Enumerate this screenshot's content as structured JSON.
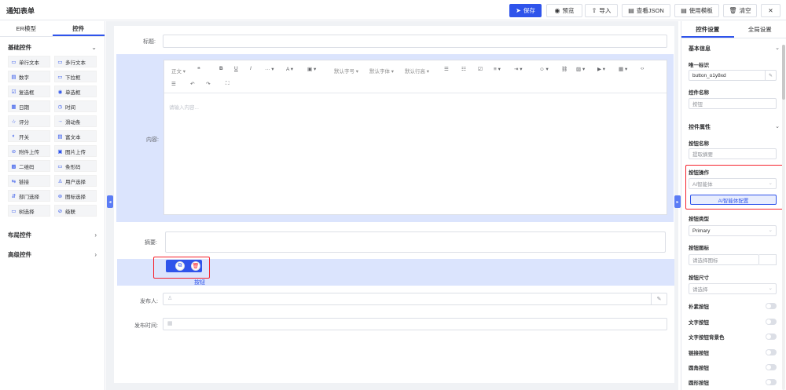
{
  "app": {
    "title": "通知表单"
  },
  "toolbar": {
    "save": "保存",
    "preview": "预览",
    "import": "导入",
    "view_json": "查看JSON",
    "use_template": "使用模板",
    "clear": "清空",
    "close": "✕"
  },
  "left_panel": {
    "tabs": [
      "ER模型",
      "控件"
    ],
    "sections": {
      "basic": "基础控件",
      "layout": "布局控件",
      "advanced": "高级控件"
    },
    "components": [
      {
        "label": "单行文本",
        "icon": "▭"
      },
      {
        "label": "多行文本",
        "icon": "▭"
      },
      {
        "label": "数字",
        "icon": "▤"
      },
      {
        "label": "下拉框",
        "icon": "▭"
      },
      {
        "label": "复选框",
        "icon": "☑"
      },
      {
        "label": "单选框",
        "icon": "◉"
      },
      {
        "label": "日期",
        "icon": "▦"
      },
      {
        "label": "时间",
        "icon": "◷"
      },
      {
        "label": "评分",
        "icon": "☆"
      },
      {
        "label": "滑动条",
        "icon": "→"
      },
      {
        "label": "开关",
        "icon": "◐"
      },
      {
        "label": "富文本",
        "icon": "▤"
      },
      {
        "label": "附件上传",
        "icon": "⊘"
      },
      {
        "label": "图片上传",
        "icon": "▣"
      },
      {
        "label": "二维码",
        "icon": "▩"
      },
      {
        "label": "条形码",
        "icon": "▭"
      },
      {
        "label": "链接",
        "icon": "⇆"
      },
      {
        "label": "用户选择",
        "icon": "♙"
      },
      {
        "label": "部门选择",
        "icon": "⇵"
      },
      {
        "label": "图标选择",
        "icon": "⊚"
      },
      {
        "label": "树选择",
        "icon": "▭"
      },
      {
        "label": "级联",
        "icon": "⊘"
      }
    ]
  },
  "form": {
    "title_label": "标题:",
    "content_label": "内容:",
    "editor": {
      "format": "正文",
      "font_size": "默认字号",
      "font_family": "默认字体",
      "line_height": "默认行高",
      "placeholder": "请输入内容..."
    },
    "summary_label": "摘要:",
    "button_caption": "按钮",
    "publisher_label": "发布人:",
    "publish_time_label": "发布时间:"
  },
  "right_panel": {
    "tabs": [
      "控件设置",
      "全局设置"
    ],
    "basic_info": "基本信息",
    "unique_id_label": "唯一标识",
    "unique_id_value": "button_o1y8xd",
    "control_name_label": "控件名称",
    "control_name_value": "按钮",
    "control_props": "控件属性",
    "button_name_label": "按钮名称",
    "button_name_value": "提取摘要",
    "button_action_label": "按钮操作",
    "button_action_value": "AI智能体",
    "ai_config_button": "AI智能体配置",
    "button_type_label": "按钮类型",
    "button_type_value": "Primary",
    "button_icon_label": "按钮图标",
    "button_icon_placeholder": "请选择图标",
    "button_size_label": "按钮尺寸",
    "button_size_placeholder": "请选择",
    "toggles": [
      "朴素按钮",
      "文字按钮",
      "文字按钮背景色",
      "链接按钮",
      "圆角按钮",
      "圆形按钮"
    ]
  }
}
